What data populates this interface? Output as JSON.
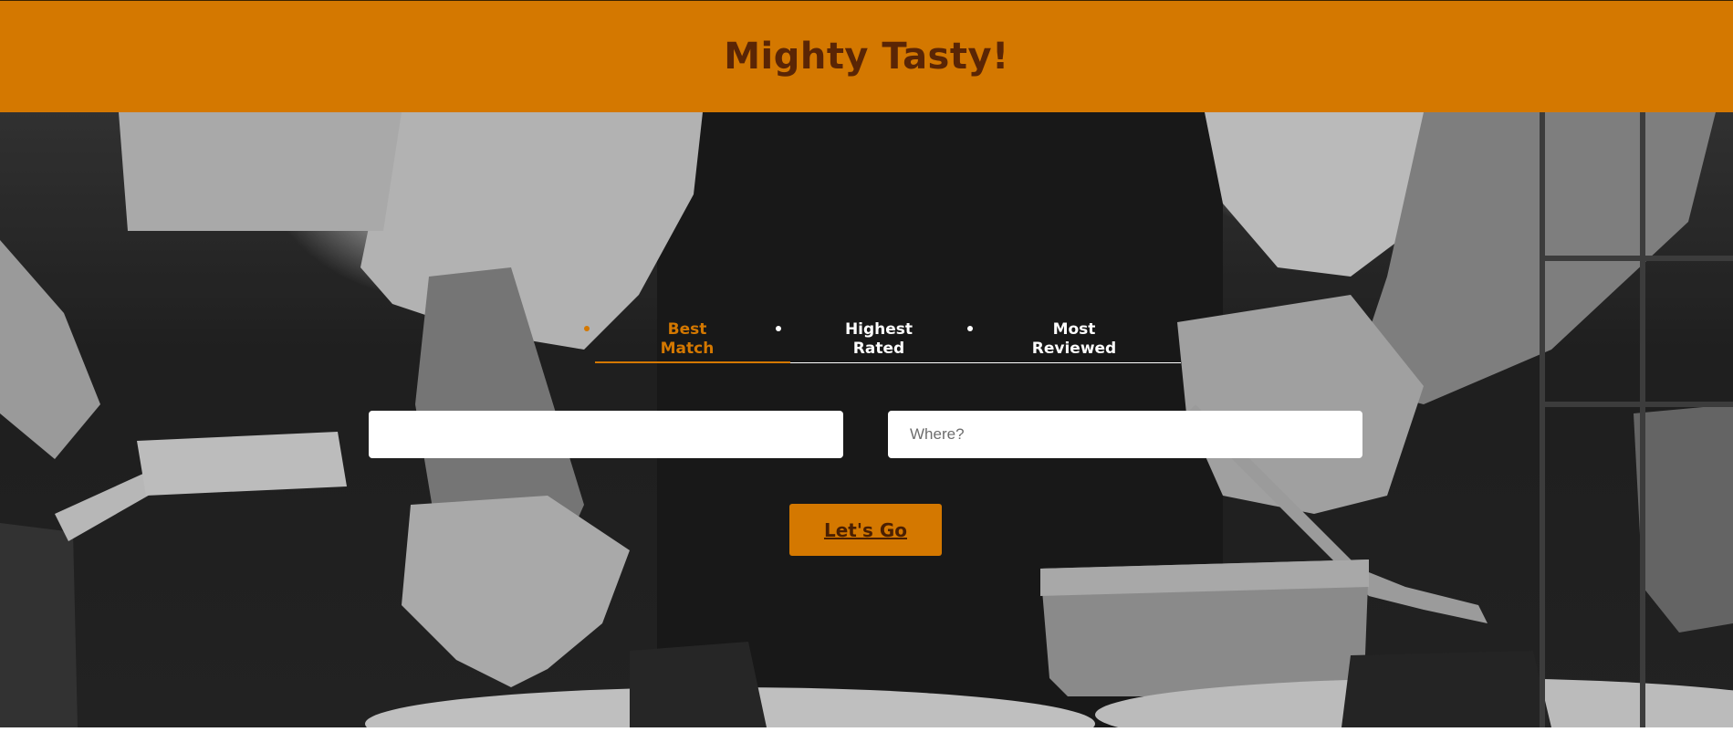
{
  "header": {
    "title": "Mighty Tasty!"
  },
  "sort_tabs": [
    {
      "line1": "Best",
      "line2": "Match",
      "active": true
    },
    {
      "line1": "Highest",
      "line2": "Rated",
      "active": false
    },
    {
      "line1": "Most",
      "line2": "Reviewed",
      "active": false
    }
  ],
  "search": {
    "what": {
      "value": "",
      "placeholder": ""
    },
    "where": {
      "value": "",
      "placeholder": "Where?"
    }
  },
  "submit": {
    "label": "Let's Go"
  },
  "colors": {
    "brand": "#d47800",
    "title": "#5a2505",
    "tab_inactive": "#ffffff"
  }
}
